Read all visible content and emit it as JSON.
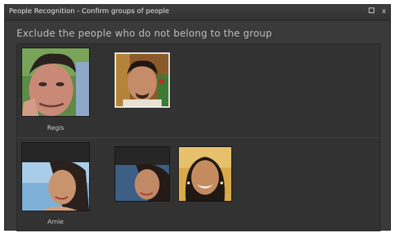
{
  "window": {
    "title": "People Recognition - Confirm groups of people",
    "maximize_icon": "maximize-icon",
    "close_icon": "close-icon",
    "close_glyph": "x"
  },
  "instruction": "Exclude the people who do not belong to the group",
  "groups": [
    {
      "name": "Regis",
      "thumbnails": [
        {
          "description_icon": "face-photo",
          "selected": true
        }
      ]
    },
    {
      "name": "Arnie",
      "thumbnails": [
        {
          "description_icon": "face-photo",
          "selected": false
        },
        {
          "description_icon": "face-photo",
          "selected": false
        }
      ]
    }
  ]
}
